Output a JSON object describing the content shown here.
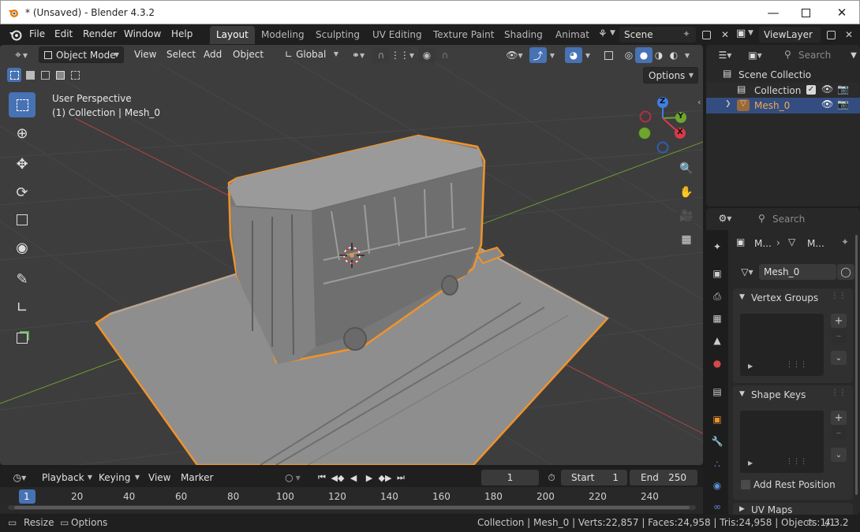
{
  "window": {
    "title": "* (Unsaved) - Blender 4.3.2",
    "controls": [
      "minimize",
      "maximize",
      "close"
    ]
  },
  "menubar": {
    "items": [
      "File",
      "Edit",
      "Render",
      "Window",
      "Help"
    ]
  },
  "workspaces": {
    "tabs": [
      "Layout",
      "Modeling",
      "Sculpting",
      "UV Editing",
      "Texture Paint",
      "Shading",
      "Animati"
    ],
    "active": "Layout"
  },
  "scene": {
    "label": "Scene"
  },
  "view_layer": {
    "label": "ViewLayer"
  },
  "viewport_header": {
    "mode": "Object Mode",
    "menus": [
      "View",
      "Select",
      "Add",
      "Object"
    ],
    "transform_orientation": "Global",
    "options_label": "Options"
  },
  "viewport": {
    "perspective_label": "User Perspective",
    "collection_label": "(1) Collection | Mesh_0",
    "gizmo": {
      "x": "X",
      "y": "Y",
      "z": "Z"
    }
  },
  "outliner": {
    "search_placeholder": "Search",
    "rows": [
      {
        "label": "Scene Collectio"
      },
      {
        "label": "Collection"
      },
      {
        "label": "Mesh_0",
        "selected": true
      }
    ]
  },
  "properties": {
    "search_placeholder": "Search",
    "breadcrumb": [
      "M...",
      "M..."
    ],
    "mesh_name": "Mesh_0",
    "panels": {
      "vertex_groups": "Vertex Groups",
      "shape_keys": "Shape Keys",
      "add_rest_position": "Add Rest Position",
      "uv_maps": "UV Maps"
    }
  },
  "timeline": {
    "menus": [
      "Playback",
      "Keying",
      "View",
      "Marker"
    ],
    "current_frame": "1",
    "start_label": "Start",
    "start_value": "1",
    "end_label": "End",
    "end_value": "250",
    "ruler": [
      "1",
      "20",
      "40",
      "60",
      "80",
      "100",
      "120",
      "140",
      "160",
      "180",
      "200",
      "220",
      "240"
    ]
  },
  "statusbar": {
    "resize_label": "Resize",
    "options_label": "Options",
    "stats": "Collection | Mesh_0 | Verts:22,857 | Faces:24,958 | Tris:24,958 | Objects:1/1",
    "version": "4.3.2"
  },
  "colors": {
    "accent": "#4772b3",
    "selection_outline": "#f0932b",
    "active_object": "#e89b3a",
    "viewport_bg": "#3d3d3d"
  }
}
